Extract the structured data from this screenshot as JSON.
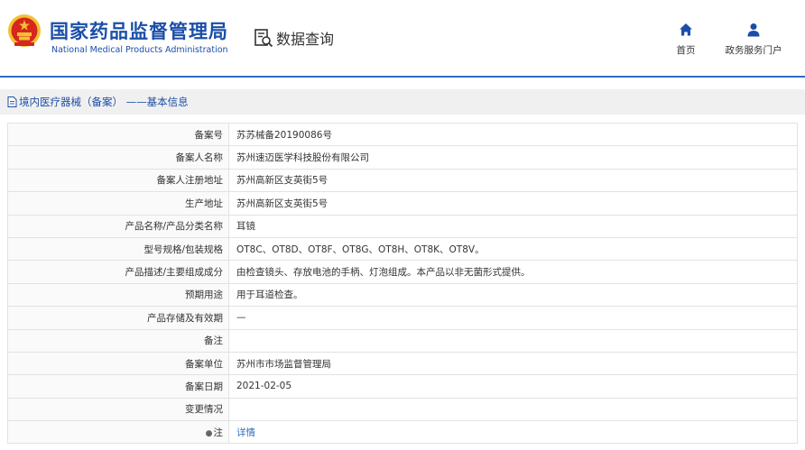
{
  "header": {
    "title_cn": "国家药品监督管理局",
    "title_en": "National Medical Products Administration",
    "query_label": "数据查询",
    "nav": [
      {
        "label": "首页",
        "icon": "home-icon"
      },
      {
        "label": "政务服务门户",
        "icon": "user-icon"
      }
    ]
  },
  "breadcrumb": {
    "icon": "document-icon",
    "text": "境内医疗器械（备案） ——基本信息"
  },
  "rows": [
    {
      "label": "备案号",
      "value": "苏苏械备20190086号"
    },
    {
      "label": "备案人名称",
      "value": "苏州速迈医学科技股份有限公司"
    },
    {
      "label": "备案人注册地址",
      "value": "苏州高新区支英街5号"
    },
    {
      "label": "生产地址",
      "value": "苏州高新区支英街5号"
    },
    {
      "label": "产品名称/产品分类名称",
      "value": "耳镜"
    },
    {
      "label": "型号规格/包装规格",
      "value": "OT8C、OT8D、OT8F、OT8G、OT8H、OT8K、OT8V。"
    },
    {
      "label": "产品描述/主要组成成分",
      "value": "由检查镜头、存放电池的手柄、灯泡组成。本产品以非无菌形式提供。"
    },
    {
      "label": "预期用途",
      "value": "用于耳道检查。"
    },
    {
      "label": "产品存储及有效期",
      "value": "—"
    },
    {
      "label": "备注",
      "value": ""
    },
    {
      "label": "备案单位",
      "value": "苏州市市场监督管理局"
    },
    {
      "label": "备案日期",
      "value": "2021-02-05"
    },
    {
      "label": "变更情况",
      "value": ""
    }
  ],
  "note_row": {
    "label": "注",
    "pin_icon": "pin-icon",
    "link": "详情"
  },
  "colors": {
    "brand_blue": "#1b4ea8",
    "link_blue": "#2f6cc2",
    "emblem_red": "#d7261e",
    "emblem_gold": "#f2c230"
  }
}
